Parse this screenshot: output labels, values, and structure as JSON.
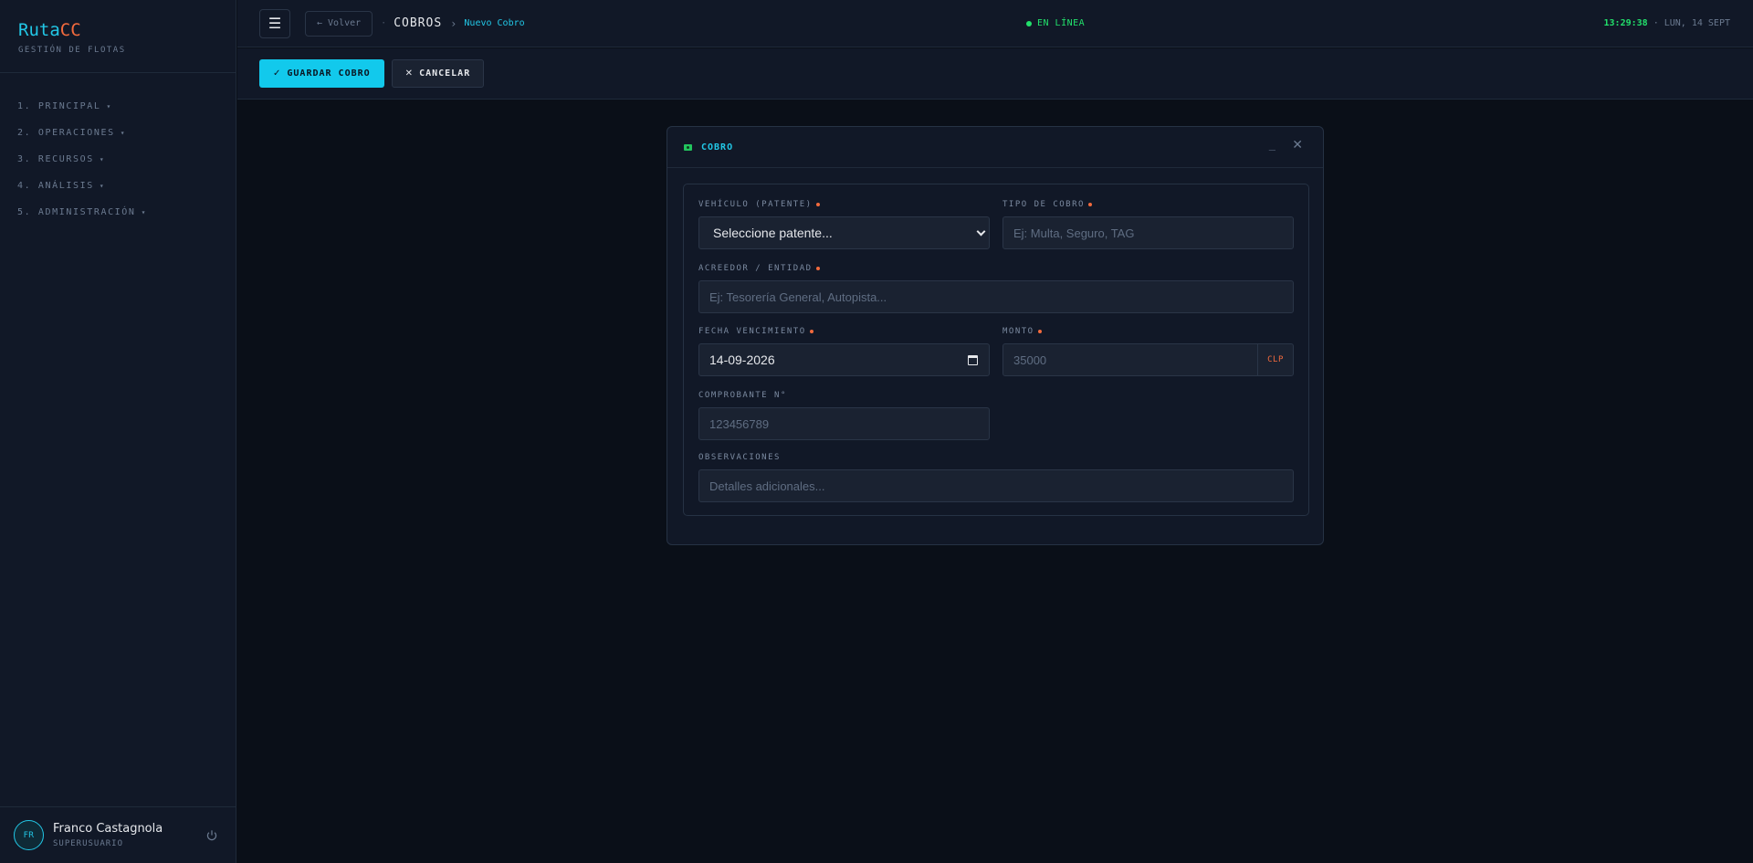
{
  "sidebar": {
    "brand_a": "Ruta",
    "brand_b": "CC",
    "subtitle": "GESTIÓN DE FLOTAS",
    "items": [
      {
        "label": "1. PRINCIPAL",
        "caret": "▾"
      },
      {
        "label": "2. OPERACIONES",
        "caret": "▾"
      },
      {
        "label": "3. RECURSOS",
        "caret": "▾"
      },
      {
        "label": "4. ANÁLISIS",
        "caret": "▾"
      },
      {
        "label": "5. ADMINISTRACIÓN",
        "caret": "▾"
      }
    ],
    "user": {
      "initials": "FR",
      "name": "Franco Castagnola",
      "role": "SUPERUSUARIO"
    }
  },
  "topbar": {
    "menu_glyph": "☰",
    "back_label": "← Volver",
    "crumb_sep": "·",
    "crumb_main": "COBROS",
    "crumb_arrow": "›",
    "crumb_current": "Nuevo Cobro",
    "status": "EN LÍNEA",
    "time": "13:29:38",
    "date": " · LUN, 14 SEPT"
  },
  "toolbar": {
    "save_icon": "✓",
    "save_label": "GUARDAR COBRO",
    "cancel_icon": "✕",
    "cancel_label": "CANCELAR"
  },
  "modal": {
    "title": "COBRO",
    "min_glyph": "_",
    "close_glyph": "✕",
    "fields": {
      "vehiculo": {
        "label": "VEHÍCULO (PATENTE)",
        "value": "Seleccione patente..."
      },
      "tipo": {
        "label": "TIPO DE COBRO",
        "placeholder": "Ej: Multa, Seguro, TAG"
      },
      "acreedor": {
        "label": "ACREEDOR / ENTIDAD",
        "placeholder": "Ej: Tesorería General, Autopista..."
      },
      "fecha": {
        "label": "FECHA VENCIMIENTO",
        "value": "14-09-2026"
      },
      "monto": {
        "label": "MONTO",
        "placeholder": "35000",
        "currency": "CLP"
      },
      "comprobante": {
        "label": "COMPROBANTE N°",
        "placeholder": "123456789"
      },
      "observaciones": {
        "label": "OBSERVACIONES",
        "placeholder": "Detalles adicionales..."
      }
    }
  },
  "colors": {
    "accent": "#22c7e6",
    "brand_orange": "#f26a3d",
    "online_green": "#22e06b",
    "background": "#0a0f18",
    "panel": "#111827"
  }
}
